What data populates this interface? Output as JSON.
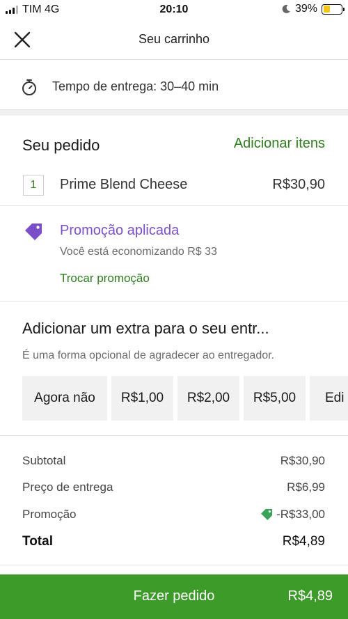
{
  "status_bar": {
    "carrier": "TIM 4G",
    "time": "20:10",
    "battery": "39%",
    "battery_level": 0.39
  },
  "header": {
    "title": "Seu carrinho",
    "close_icon": "close-icon"
  },
  "delivery": {
    "text": "Tempo de entrega: 30–40 min",
    "icon": "stopwatch-icon"
  },
  "order": {
    "title": "Seu pedido",
    "add_items": "Adicionar itens",
    "items": [
      {
        "qty": "1",
        "name": "Prime Blend Cheese",
        "price": "R$30,90"
      }
    ]
  },
  "promo": {
    "icon": "tag-icon",
    "title": "Promoção aplicada",
    "subtitle": "Você está economizando R$ 33",
    "change": "Trocar promoção"
  },
  "tip": {
    "title": "Adicionar um extra para o seu entr...",
    "subtitle": "É uma forma opcional de agradecer ao entregador.",
    "options": [
      "Agora não",
      "R$1,00",
      "R$2,00",
      "R$5,00",
      "Edi"
    ]
  },
  "summary": {
    "subtotal_label": "Subtotal",
    "subtotal_value": "R$30,90",
    "delivery_label": "Preço de entrega",
    "delivery_value": "R$6,99",
    "promo_label": "Promoção",
    "promo_value": "-R$33,00",
    "total_label": "Total",
    "total_value": "R$4,89"
  },
  "cta": {
    "label": "Fazer pedido",
    "price": "R$4,89"
  },
  "colors": {
    "green": "#3c9b29",
    "link_green": "#2f7d1e",
    "promo_purple": "#7b4fc9",
    "tag_green": "#3aa35a"
  }
}
